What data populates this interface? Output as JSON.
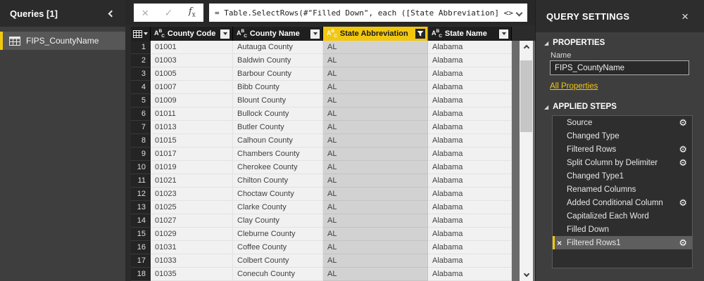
{
  "colors": {
    "accent": "#f2c80f"
  },
  "sidebar": {
    "title": "Queries [1]",
    "items": [
      {
        "label": "FIPS_CountyName",
        "selected": true
      }
    ]
  },
  "formula_bar": {
    "formula": "= Table.SelectRows(#\"Filled Down\", each ([State Abbreviation] <>"
  },
  "table": {
    "columns": [
      {
        "label": "County Code",
        "type": "ABC",
        "filtered": false,
        "selected": false
      },
      {
        "label": "County Name",
        "type": "ABC",
        "filtered": false,
        "selected": false
      },
      {
        "label": "State Abbreviation",
        "type": "ABC",
        "filtered": true,
        "selected": true
      },
      {
        "label": "State Name",
        "type": "ABC",
        "filtered": false,
        "selected": false
      }
    ],
    "rows": [
      {
        "n": "1",
        "county_code": "01001",
        "county_name": "Autauga County",
        "state_abbreviation": "AL",
        "state_name": "Alabama"
      },
      {
        "n": "2",
        "county_code": "01003",
        "county_name": "Baldwin County",
        "state_abbreviation": "AL",
        "state_name": "Alabama"
      },
      {
        "n": "3",
        "county_code": "01005",
        "county_name": "Barbour County",
        "state_abbreviation": "AL",
        "state_name": "Alabama"
      },
      {
        "n": "4",
        "county_code": "01007",
        "county_name": "Bibb County",
        "state_abbreviation": "AL",
        "state_name": "Alabama"
      },
      {
        "n": "5",
        "county_code": "01009",
        "county_name": "Blount County",
        "state_abbreviation": "AL",
        "state_name": "Alabama"
      },
      {
        "n": "6",
        "county_code": "01011",
        "county_name": "Bullock County",
        "state_abbreviation": "AL",
        "state_name": "Alabama"
      },
      {
        "n": "7",
        "county_code": "01013",
        "county_name": "Butler County",
        "state_abbreviation": "AL",
        "state_name": "Alabama"
      },
      {
        "n": "8",
        "county_code": "01015",
        "county_name": "Calhoun County",
        "state_abbreviation": "AL",
        "state_name": "Alabama"
      },
      {
        "n": "9",
        "county_code": "01017",
        "county_name": "Chambers County",
        "state_abbreviation": "AL",
        "state_name": "Alabama"
      },
      {
        "n": "10",
        "county_code": "01019",
        "county_name": "Cherokee County",
        "state_abbreviation": "AL",
        "state_name": "Alabama"
      },
      {
        "n": "11",
        "county_code": "01021",
        "county_name": "Chilton County",
        "state_abbreviation": "AL",
        "state_name": "Alabama"
      },
      {
        "n": "12",
        "county_code": "01023",
        "county_name": "Choctaw County",
        "state_abbreviation": "AL",
        "state_name": "Alabama"
      },
      {
        "n": "13",
        "county_code": "01025",
        "county_name": "Clarke County",
        "state_abbreviation": "AL",
        "state_name": "Alabama"
      },
      {
        "n": "14",
        "county_code": "01027",
        "county_name": "Clay County",
        "state_abbreviation": "AL",
        "state_name": "Alabama"
      },
      {
        "n": "15",
        "county_code": "01029",
        "county_name": "Cleburne County",
        "state_abbreviation": "AL",
        "state_name": "Alabama"
      },
      {
        "n": "16",
        "county_code": "01031",
        "county_name": "Coffee County",
        "state_abbreviation": "AL",
        "state_name": "Alabama"
      },
      {
        "n": "17",
        "county_code": "01033",
        "county_name": "Colbert County",
        "state_abbreviation": "AL",
        "state_name": "Alabama"
      },
      {
        "n": "18",
        "county_code": "01035",
        "county_name": "Conecuh County",
        "state_abbreviation": "AL",
        "state_name": "Alabama"
      }
    ]
  },
  "query_settings": {
    "title": "QUERY SETTINGS",
    "properties": {
      "section": "PROPERTIES",
      "name_label": "Name",
      "name_value": "FIPS_CountyName",
      "all_properties_link": "All Properties"
    },
    "applied_steps": {
      "section": "APPLIED STEPS",
      "steps": [
        {
          "label": "Source",
          "gear": true,
          "selected": false
        },
        {
          "label": "Changed Type",
          "gear": false,
          "selected": false
        },
        {
          "label": "Filtered Rows",
          "gear": true,
          "selected": false
        },
        {
          "label": "Split Column by Delimiter",
          "gear": true,
          "selected": false
        },
        {
          "label": "Changed Type1",
          "gear": false,
          "selected": false
        },
        {
          "label": "Renamed Columns",
          "gear": false,
          "selected": false
        },
        {
          "label": "Added Conditional Column",
          "gear": true,
          "selected": false
        },
        {
          "label": "Capitalized Each Word",
          "gear": false,
          "selected": false
        },
        {
          "label": "Filled Down",
          "gear": false,
          "selected": false
        },
        {
          "label": "Filtered Rows1",
          "gear": true,
          "selected": true
        }
      ]
    }
  }
}
